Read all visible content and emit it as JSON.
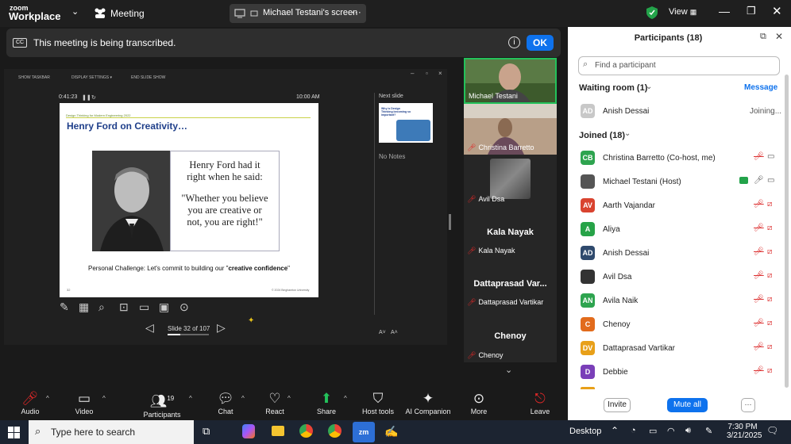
{
  "titlebar": {
    "logo_top": "zoom",
    "logo_bottom": "Workplace",
    "meeting_label": "Meeting",
    "share_label": "Michael Testani's screen",
    "view_label": "View"
  },
  "banner": {
    "cc": "CC",
    "text": "This meeting is being transcribed.",
    "ok_label": "OK"
  },
  "presenter": {
    "toolbar_items": [
      "SHOW TASKBAR",
      "DISPLAY SETTINGS ▾",
      "END SLIDE SHOW"
    ],
    "elapsed": "0:41:23",
    "clock": "10:00 AM",
    "next_slide_label": "Next slide",
    "no_notes": "No Notes",
    "slide_counter": "Slide 32 of 107"
  },
  "slide": {
    "header_small": "Design Thinking for Modern Engineering 2022",
    "title": "Henry Ford on Creativity…",
    "quote_line1": "Henry Ford had it",
    "quote_line2": "right when he said:",
    "quote_line3": "\"Whether you believe",
    "quote_line4": "you are creative or",
    "quote_line5": "not, you are right!\"",
    "challenge_prefix": "Personal Challenge: Let's commit to building our \"",
    "challenge_bold": "creative confidence",
    "challenge_suffix": "\"",
    "page_num": "32",
    "footer": "© 2024 Binghamton University"
  },
  "next_slide": {
    "title": "Why is Design Thinking becoming so important?"
  },
  "videos": [
    {
      "name": "Michael Testani",
      "type": "camera",
      "muted": false
    },
    {
      "name": "Christina Barretto",
      "type": "camera",
      "muted": true
    },
    {
      "name": "Avil Dsa",
      "type": "blur",
      "muted": true
    },
    {
      "name": "Kala Nayak",
      "big": "Kala Nayak",
      "type": "text",
      "muted": true
    },
    {
      "name": "Dattaprasad Vartikar",
      "big": "Dattaprasad Var...",
      "type": "text",
      "muted": true
    },
    {
      "name": "Chenoy",
      "big": "Chenoy",
      "type": "text",
      "muted": true
    }
  ],
  "participants": {
    "title": "Participants (18)",
    "search_placeholder": "Find a participant",
    "waiting_title": "Waiting room (1)",
    "message_label": "Message",
    "waiting": [
      {
        "initials": "AD",
        "name": "Anish Dessai",
        "status": "Joining...",
        "color": "#c8c8c8"
      }
    ],
    "joined_title": "Joined (18)",
    "joined": [
      {
        "initials": "CB",
        "name": "Christina Barretto (Co-host, me)",
        "color": "#2ea44f"
      },
      {
        "initials": "",
        "name": "Michael Testani (Host)",
        "color": "#555555"
      },
      {
        "initials": "AV",
        "name": "Aarth Vajandar",
        "color": "#d9432f"
      },
      {
        "initials": "A",
        "name": "Aliya",
        "color": "#27a348"
      },
      {
        "initials": "AD",
        "name": "Anish Dessai",
        "color": "#2f4a6d"
      },
      {
        "initials": "",
        "name": "Avil Dsa",
        "color": "#333333"
      },
      {
        "initials": "AN",
        "name": "Avila Naik",
        "color": "#2ea44f"
      },
      {
        "initials": "C",
        "name": "Chenoy",
        "color": "#e26b1c"
      },
      {
        "initials": "DV",
        "name": "Dattaprasad Vartikar",
        "color": "#e8a019"
      },
      {
        "initials": "D",
        "name": "Debbie",
        "color": "#7a3fb8"
      }
    ],
    "invite_label": "Invite",
    "mute_all_label": "Mute all",
    "more_label": "···"
  },
  "toolbar": {
    "audio": "Audio",
    "video": "Video",
    "participants": "Participants",
    "participants_count": "19",
    "chat": "Chat",
    "react": "React",
    "share": "Share",
    "host_tools": "Host tools",
    "ai_companion": "AI Companion",
    "more": "More",
    "leave": "Leave"
  },
  "taskbar": {
    "search_placeholder": "Type here to search",
    "desktop": "Desktop",
    "time": "7:30 PM",
    "date": "3/21/2025"
  }
}
